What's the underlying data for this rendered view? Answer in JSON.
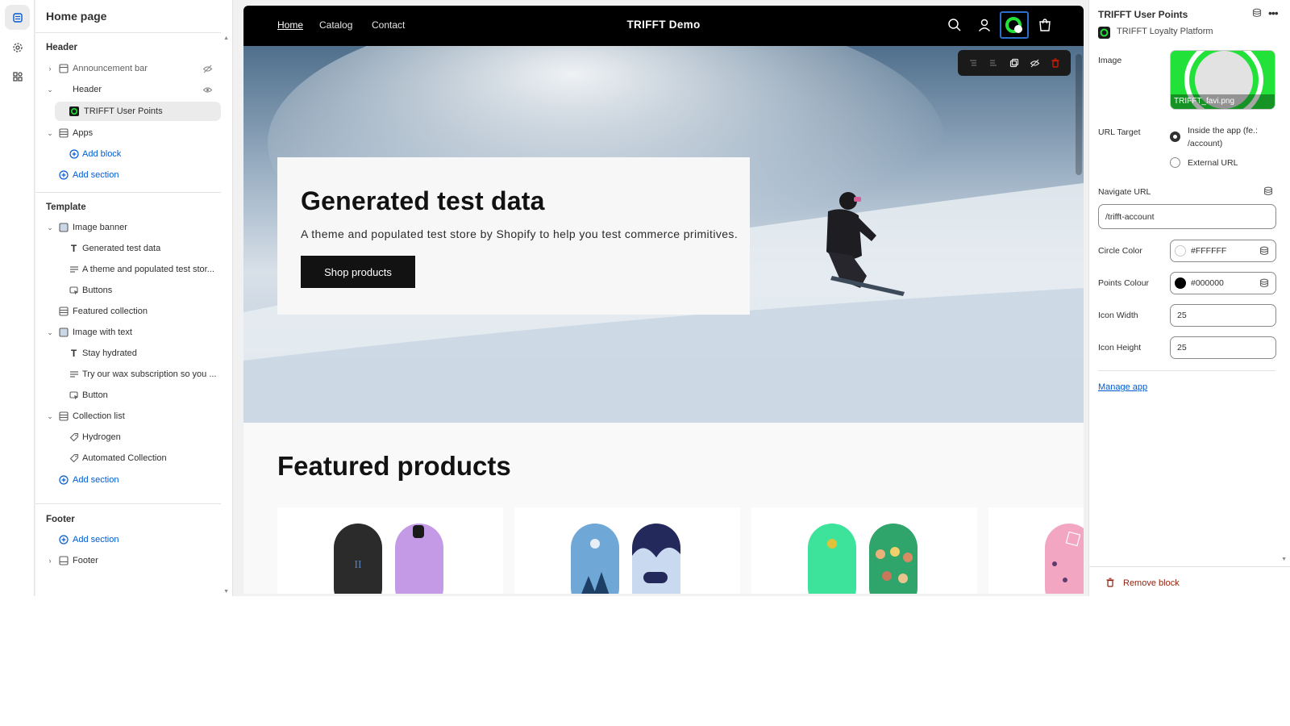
{
  "left_panel": {
    "title": "Home page",
    "header_section": {
      "label": "Header",
      "items": [
        {
          "label": "Announcement bar"
        },
        {
          "label": "Header"
        },
        {
          "label": "TRIFFT User Points"
        },
        {
          "label": "Apps"
        },
        {
          "label": "Add block"
        },
        {
          "label": "Add section"
        }
      ]
    },
    "template_section": {
      "label": "Template",
      "items": [
        {
          "label": "Image banner"
        },
        {
          "label": "Generated test data"
        },
        {
          "label": "A theme and populated test stor..."
        },
        {
          "label": "Buttons"
        },
        {
          "label": "Featured collection"
        },
        {
          "label": "Image with text"
        },
        {
          "label": "Stay hydrated"
        },
        {
          "label": "Try our wax subscription so you ..."
        },
        {
          "label": "Button"
        },
        {
          "label": "Collection list"
        },
        {
          "label": "Hydrogen"
        },
        {
          "label": "Automated Collection"
        },
        {
          "label": "Add section"
        }
      ]
    },
    "footer_section": {
      "label": "Footer",
      "items": [
        {
          "label": "Add section"
        },
        {
          "label": "Footer"
        }
      ]
    }
  },
  "preview": {
    "nav": {
      "home": "Home",
      "catalog": "Catalog",
      "contact": "Contact",
      "brand": "TRIFFT Demo"
    },
    "hero": {
      "title": "Generated test data",
      "subtitle": "A theme and populated test store by Shopify to help you test commerce primitives.",
      "button": "Shop products"
    },
    "featured": {
      "title": "Featured products"
    }
  },
  "settings": {
    "title": "TRIFFT User Points",
    "app_name": "TRIFFT Loyalty Platform",
    "image_label": "Image",
    "image_filename": "TRIFFT_favi.png",
    "url_target_label": "URL Target",
    "url_target_options": [
      "Inside the app (fe.: /account)",
      "External URL"
    ],
    "navigate_url_label": "Navigate URL",
    "navigate_url_value": "/trifft-account",
    "circle_color_label": "Circle Color",
    "circle_color_value": "#FFFFFF",
    "points_colour_label": "Points Colour",
    "points_colour_value": "#000000",
    "icon_width_label": "Icon Width",
    "icon_width_value": "25",
    "icon_height_label": "Icon Height",
    "icon_height_value": "25",
    "manage_app": "Manage app",
    "remove_block": "Remove block"
  },
  "colors": {
    "accent": "#005bd3",
    "brand_green": "#22e23a",
    "danger": "#8e1f0b"
  }
}
